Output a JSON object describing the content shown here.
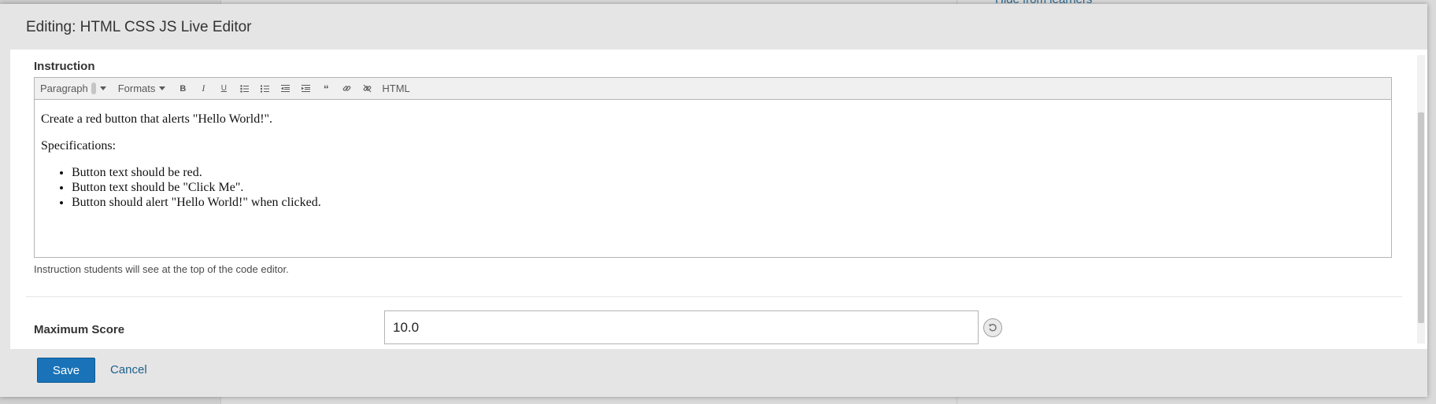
{
  "background": {
    "link_text": "Hide from learners"
  },
  "modal": {
    "title": "Editing: HTML CSS JS Live Editor"
  },
  "instruction": {
    "label": "Instruction",
    "toolbar": {
      "paragraph": "Paragraph",
      "formats": "Formats",
      "html": "HTML",
      "icons": [
        "bold-icon",
        "italic-icon",
        "underline-icon",
        "bullet-list-icon",
        "numbered-list-icon",
        "outdent-icon",
        "indent-icon",
        "blockquote-icon",
        "link-icon",
        "unlink-icon"
      ]
    },
    "content": {
      "line1": "Create a red button that alerts \"Hello World!\".",
      "line2": "Specifications:",
      "bullets": [
        "Button text should be red.",
        "Button text should be \"Click Me\".",
        "Button should alert \"Hello World!\" when clicked."
      ]
    },
    "help": "Instruction students will see at the top of the code editor."
  },
  "max_score": {
    "label": "Maximum Score",
    "value": "10.0"
  },
  "footer": {
    "save": "Save",
    "cancel": "Cancel"
  },
  "colors": {
    "primary": "#1a73b8",
    "link": "#1e5f8a"
  }
}
